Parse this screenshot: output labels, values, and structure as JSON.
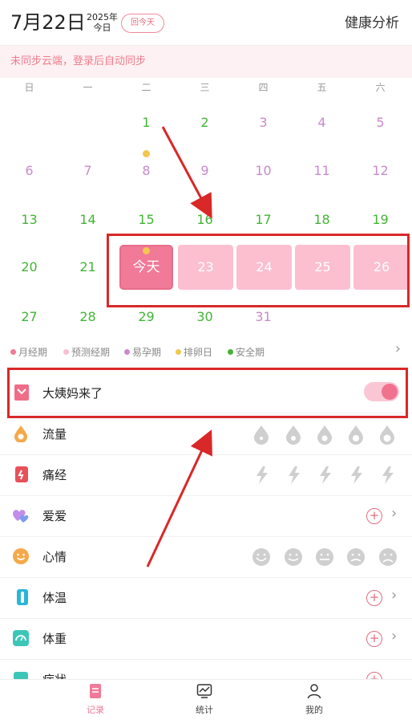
{
  "header": {
    "date": "7月22日",
    "year": "2025年",
    "today_word": "今日",
    "back_today": "回今天",
    "analysis": "健康分析"
  },
  "sync_banner": "未同步云端，登录后自动同步",
  "calendar": {
    "weekdays": [
      "日",
      "一",
      "二",
      "三",
      "四",
      "五",
      "六"
    ],
    "row1": [
      "1",
      "2",
      "3",
      "4",
      "5"
    ],
    "row2": [
      "6",
      "7",
      "8",
      "9",
      "10",
      "11",
      "12"
    ],
    "row3": [
      "13",
      "14",
      "15",
      "16",
      "17",
      "18",
      "19"
    ],
    "row4": [
      "20",
      "21",
      "今天",
      "23",
      "24",
      "25",
      "26"
    ],
    "row5": [
      "27",
      "28",
      "29",
      "30",
      "31"
    ]
  },
  "legend": [
    "月经期",
    "预测经期",
    "易孕期",
    "排卵日",
    "安全期"
  ],
  "colors": {
    "period": "#f07a98",
    "predicted": "#fbbfd0",
    "fertile": "#c98acc",
    "ovulation": "#f3c64e",
    "safe": "#43b436",
    "accent": "#e86b80"
  },
  "records": {
    "period_came": "大姨妈来了",
    "period_toggle_on": true,
    "flow": "流量",
    "pain": "痛经",
    "love": "爱爱",
    "mood": "心情",
    "temperature": "体温",
    "weight": "体重",
    "symptom": "症状"
  },
  "tabs": {
    "record": "记录",
    "stats": "统计",
    "mine": "我的"
  }
}
